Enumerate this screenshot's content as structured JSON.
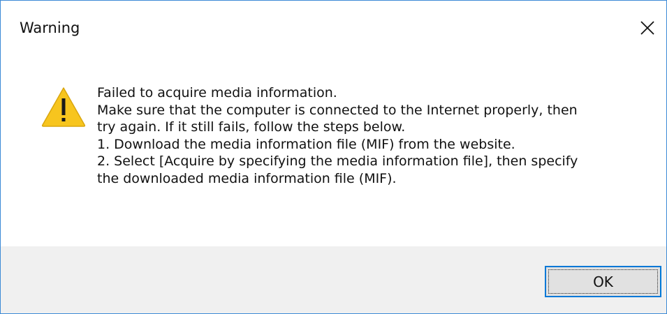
{
  "window": {
    "title": "Warning",
    "close_icon": "close-icon"
  },
  "message": {
    "icon": "warning-icon",
    "lines": [
      "Failed to acquire media information.",
      "Make sure that the computer is connected to the Internet properly, then",
      "try again. If it still fails, follow the steps below.",
      "1. Download the media information file (MIF) from the website.",
      "2. Select [Acquire by specifying the media information file], then specify",
      "the downloaded media information file (MIF)."
    ]
  },
  "buttons": {
    "ok_label": "OK"
  },
  "colors": {
    "window_border": "#3c8ad6",
    "footer_background": "#f0f0f0",
    "button_focus_border": "#0078d7",
    "warning_fill": "#f7c51e"
  }
}
